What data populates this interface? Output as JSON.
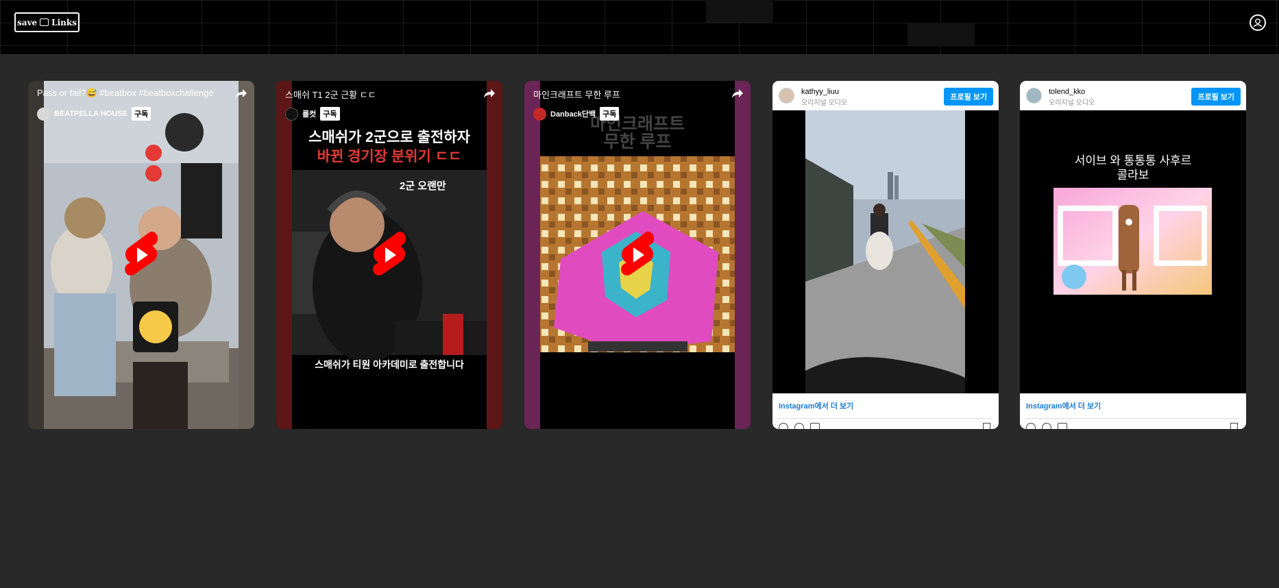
{
  "header": {
    "logo_left": "save",
    "logo_right": "Links",
    "profile_icon": "user-icon"
  },
  "shorts": [
    {
      "title": "Pass or fail?😅 #beatbox #beatboxchallenge",
      "channel": "BEATPELLA HOUSE",
      "subscribe": "구독",
      "overlay_lines": [],
      "caption": ""
    },
    {
      "title": "스매쉬 T1 2군 근황 ㄷㄷ",
      "channel": "롤컷",
      "subscribe": "구독",
      "overlay_lines": [
        "스매쉬가 2군으로 출전하자",
        "바뀐 경기장 분위기 ㄷㄷ",
        "2군 오랜만"
      ],
      "caption": "스매쉬가 티원 아카데미로 출전합니다"
    },
    {
      "title": "마인크래프트 무한 루프",
      "channel": "Danback단백",
      "subscribe": "구독",
      "overlay_lines": [
        "마인크래프트",
        "무한 루프"
      ],
      "caption": ""
    }
  ],
  "instagram": [
    {
      "username": "kathyy_liuu",
      "audio": "오리지널 오디오",
      "follow": "프로필 보기",
      "more": "Instagram에서 더 보기",
      "overlay_lines": []
    },
    {
      "username": "tolend_kko",
      "audio": "오리지널 오디오",
      "follow": "프로필 보기",
      "more": "Instagram에서 더 보기",
      "overlay_lines": [
        "서이브 와 통통통 사후르",
        "콜라보"
      ]
    }
  ],
  "colors": {
    "page_bg": "#292929",
    "header_bg": "#000000",
    "follow_button": "#0095f6",
    "more_link": "#1b7bd0",
    "shorts_play": "#ff0000"
  }
}
